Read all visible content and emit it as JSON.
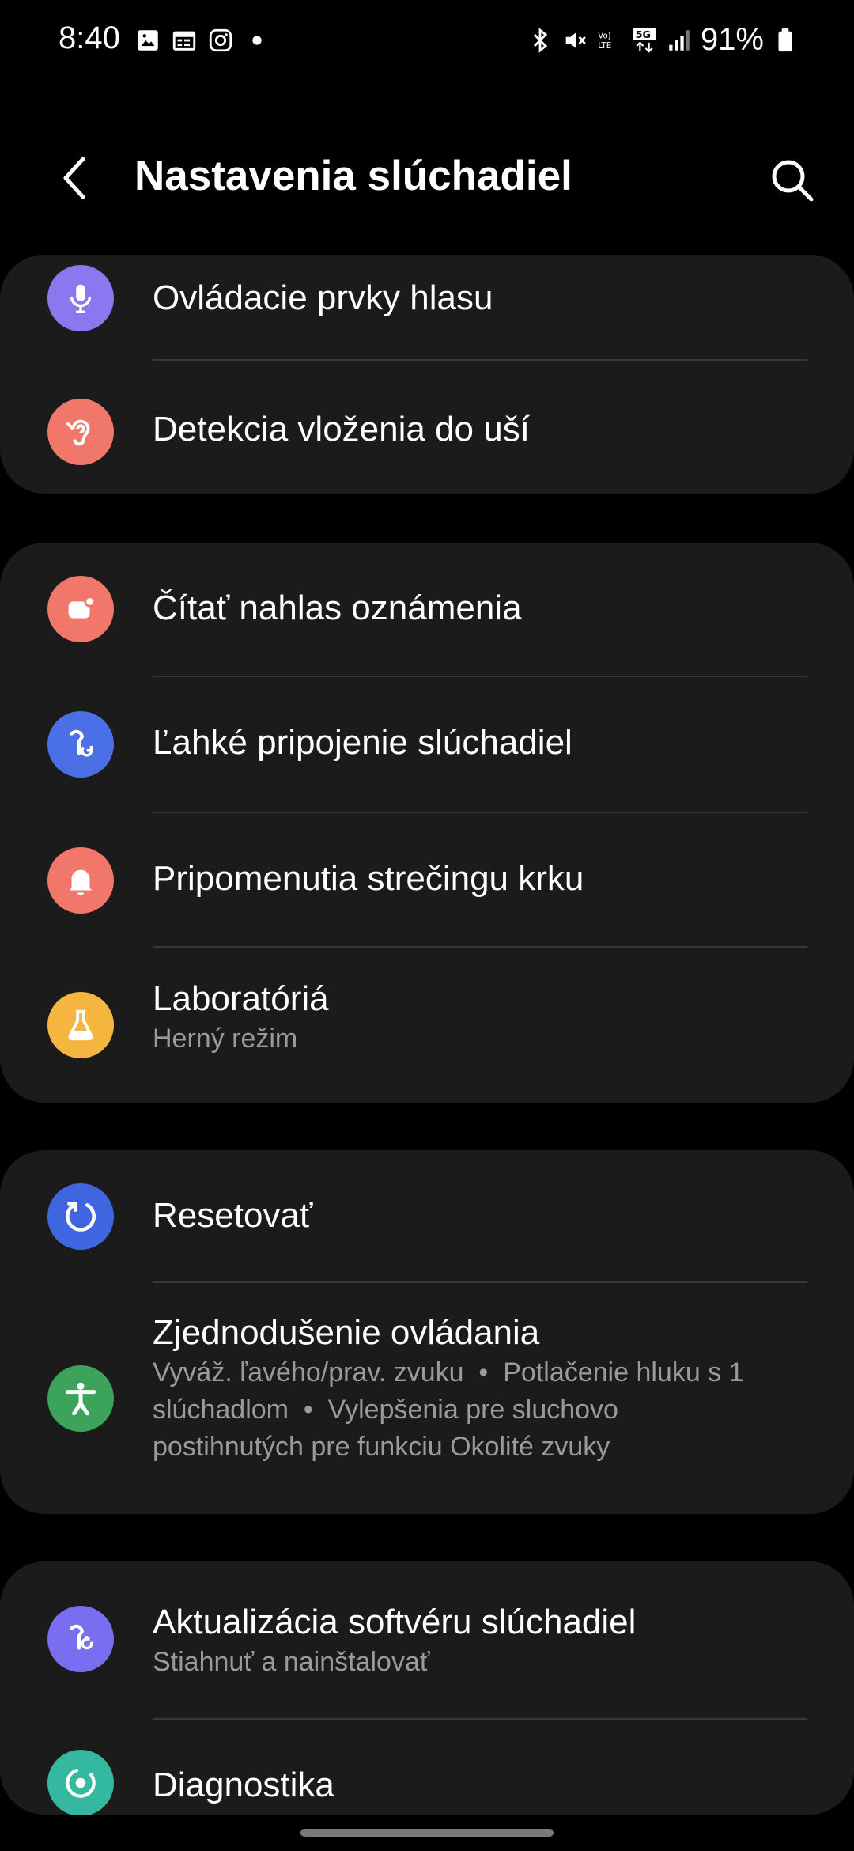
{
  "status_bar": {
    "time": "8:40",
    "left_icons": [
      "gallery-icon",
      "calendar-icon",
      "instagram-icon",
      "dot-icon"
    ],
    "right_icons": [
      "bluetooth-icon",
      "mute-icon",
      "volte-icon",
      "5g-icon",
      "signal-icon"
    ],
    "battery": "91%"
  },
  "header": {
    "title": "Nastavenia slúchadiel"
  },
  "cards": [
    {
      "items": [
        {
          "icon": "microphone-icon",
          "icon_color": "#8a78f0",
          "title": "Ovládacie prvky hlasu",
          "subtitle": ""
        },
        {
          "icon": "ear-icon",
          "icon_color": "#f0776a",
          "title": "Detekcia vloženia do uší",
          "subtitle": ""
        }
      ]
    },
    {
      "items": [
        {
          "icon": "notification-read-icon",
          "icon_color": "#f0776a",
          "title": "Čítať nahlas oznámenia",
          "subtitle": ""
        },
        {
          "icon": "earbuds-connect-icon",
          "icon_color": "#4a6fe6",
          "title": "Ľahké pripojenie slúchadiel",
          "subtitle": ""
        },
        {
          "icon": "bell-icon",
          "icon_color": "#f0776a",
          "title": "Pripomenutia strečingu krku",
          "subtitle": ""
        },
        {
          "icon": "flask-icon",
          "icon_color": "#f4b63f",
          "title": "Laboratóriá",
          "subtitle": "Herný režim"
        }
      ]
    },
    {
      "items": [
        {
          "icon": "reset-icon",
          "icon_color": "#3f66e0",
          "title": "Resetovať",
          "subtitle": ""
        },
        {
          "icon": "accessibility-icon",
          "icon_color": "#3ba35a",
          "title": "Zjednodušenie ovládania",
          "subtitle": "Vyváž. ľavého/prav. zvuku  •  Potlačenie hluku s 1 slúchadlom  •  Vylepšenia pre sluchovo postihnutých pre funkciu Okolité zvuky"
        }
      ]
    },
    {
      "items": [
        {
          "icon": "software-update-icon",
          "icon_color": "#7a6ef0",
          "title": "Aktualizácia softvéru slúchadiel",
          "subtitle": "Stiahnuť a nainštalovať"
        },
        {
          "icon": "diagnostics-icon",
          "icon_color": "#35b8a0",
          "title": "Diagnostika",
          "subtitle": ""
        }
      ]
    }
  ]
}
